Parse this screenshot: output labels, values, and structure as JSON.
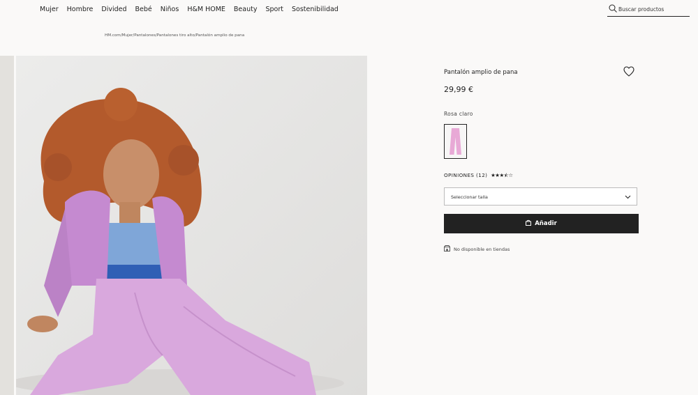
{
  "nav": {
    "items": [
      {
        "label": "Mujer"
      },
      {
        "label": "Hombre"
      },
      {
        "label": "Divided"
      },
      {
        "label": "Bebé"
      },
      {
        "label": "Niños"
      },
      {
        "label": "H&M HOME"
      },
      {
        "label": "Beauty"
      },
      {
        "label": "Sport"
      },
      {
        "label": "Sostenibilidad"
      }
    ],
    "search_placeholder": "Buscar productos"
  },
  "breadcrumb": "HM.com/Mujer/Pantalones/Pantalones tiro alto/Pantalón amplio de pana",
  "product": {
    "title": "Pantalón amplio de pana",
    "price": "29,99 €",
    "color_name": "Rosa claro",
    "swatch_color": "#e8a9d6",
    "reviews_label": "OPINIONES (12)",
    "rating": 3.5,
    "rating_max": 5,
    "size_placeholder": "Seleccionar talla",
    "add_label": "Añadir",
    "store_note": "No disponible en tiendas"
  },
  "colors": {
    "accent_dark": "#222222",
    "background": "#faf9f8",
    "garment_pink": "#d9a8dd"
  }
}
